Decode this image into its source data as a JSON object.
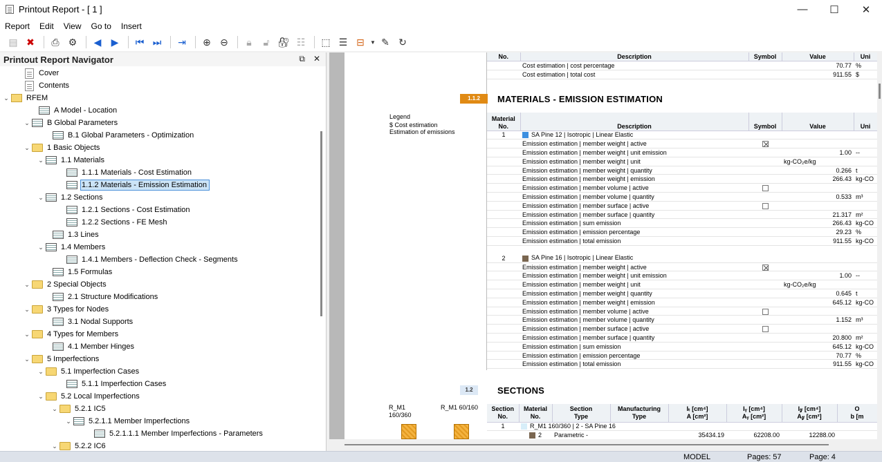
{
  "window": {
    "title": "Printout Report - [ 1 ]",
    "controls": [
      "—",
      "☐",
      "✕"
    ]
  },
  "menu": [
    "Report",
    "Edit",
    "View",
    "Go to",
    "Insert"
  ],
  "toolbar": [
    "new-icon",
    "delete-icon",
    "print-icon",
    "print-settings-icon",
    "back-icon",
    "forward-icon",
    "first-page-icon",
    "last-page-icon",
    "goto-page-icon",
    "zoom-in-icon",
    "zoom-out-icon",
    "lock-icon",
    "unlock-icon",
    "lock-all-icon",
    "columns-icon",
    "page-setup-icon",
    "filter-icon",
    "export-icon",
    "edit-icon",
    "refresh-icon"
  ],
  "navigator": {
    "title": "Printout Report Navigator",
    "pin": "⧉",
    "close": "✕",
    "items": [
      {
        "label": "Cover",
        "icon": "doc",
        "level": 1,
        "tw": ""
      },
      {
        "label": "Contents",
        "icon": "doc",
        "level": 1,
        "tw": ""
      },
      {
        "label": "RFEM",
        "icon": "rfem",
        "level": 0,
        "tw": "⌄"
      },
      {
        "label": "A Model - Location",
        "icon": "table",
        "level": 2,
        "tw": ""
      },
      {
        "label": "B Global Parameters",
        "icon": "table",
        "level": 1.5,
        "tw": "⌄"
      },
      {
        "label": "B.1 Global Parameters - Optimization",
        "icon": "table",
        "level": 3,
        "tw": ""
      },
      {
        "label": "1 Basic Objects",
        "icon": "folder",
        "level": 1.5,
        "tw": "⌄"
      },
      {
        "label": "1.1 Materials",
        "icon": "table",
        "level": 2.5,
        "tw": "⌄"
      },
      {
        "label": "1.1.1 Materials - Cost Estimation",
        "icon": "table",
        "level": 4,
        "tw": ""
      },
      {
        "label": "1.1.2 Materials - Emission Estimation",
        "icon": "table",
        "level": 4,
        "tw": "",
        "selected": true
      },
      {
        "label": "1.2 Sections",
        "icon": "table",
        "level": 2.5,
        "tw": "⌄"
      },
      {
        "label": "1.2.1 Sections - Cost Estimation",
        "icon": "table",
        "level": 4,
        "tw": ""
      },
      {
        "label": "1.2.2 Sections - FE Mesh",
        "icon": "table",
        "level": 4,
        "tw": ""
      },
      {
        "label": "1.3 Lines",
        "icon": "table",
        "level": 3,
        "tw": ""
      },
      {
        "label": "1.4 Members",
        "icon": "table",
        "level": 2.5,
        "tw": "⌄"
      },
      {
        "label": "1.4.1 Members - Deflection Check - Segments",
        "icon": "table",
        "level": 4,
        "tw": ""
      },
      {
        "label": "1.5 Formulas",
        "icon": "table",
        "level": 3,
        "tw": ""
      },
      {
        "label": "2 Special Objects",
        "icon": "folder",
        "level": 1.5,
        "tw": "⌄"
      },
      {
        "label": "2.1 Structure Modifications",
        "icon": "table",
        "level": 3,
        "tw": ""
      },
      {
        "label": "3 Types for Nodes",
        "icon": "folder",
        "level": 1.5,
        "tw": "⌄"
      },
      {
        "label": "3.1 Nodal Supports",
        "icon": "table",
        "level": 3,
        "tw": ""
      },
      {
        "label": "4 Types for Members",
        "icon": "folder",
        "level": 1.5,
        "tw": "⌄"
      },
      {
        "label": "4.1 Member Hinges",
        "icon": "table",
        "level": 3,
        "tw": ""
      },
      {
        "label": "5 Imperfections",
        "icon": "folder",
        "level": 1.5,
        "tw": "⌄"
      },
      {
        "label": "5.1 Imperfection Cases",
        "icon": "folder",
        "level": 2.5,
        "tw": "⌄"
      },
      {
        "label": "5.1.1 Imperfection Cases",
        "icon": "table",
        "level": 4,
        "tw": ""
      },
      {
        "label": "5.2 Local Imperfections",
        "icon": "folder",
        "level": 2.5,
        "tw": "⌄"
      },
      {
        "label": "5.2.1 IC5",
        "icon": "folder",
        "level": 3.5,
        "tw": "⌄"
      },
      {
        "label": "5.2.1.1 Member Imperfections",
        "icon": "table",
        "level": 4.5,
        "tw": "⌄"
      },
      {
        "label": "5.2.1.1.1 Member Imperfections - Parameters",
        "icon": "table",
        "level": 6,
        "tw": ""
      },
      {
        "label": "5.2.2 IC6",
        "icon": "folder",
        "level": 3.5,
        "tw": "⌄"
      }
    ]
  },
  "report": {
    "top_table": {
      "headers": [
        "No.",
        "Description",
        "Symbol",
        "Value",
        "Uni"
      ],
      "rows": [
        [
          "Cost estimation | cost percentage",
          "",
          "70.77",
          "%"
        ],
        [
          "Cost estimation | total cost",
          "",
          "911.55",
          "$"
        ]
      ]
    },
    "section_112": {
      "num": "1.1.2",
      "title": "MATERIALS - EMISSION ESTIMATION"
    },
    "legend": {
      "title": "Legend",
      "items": [
        "$  Cost estimation",
        "Estimation of emissions"
      ]
    },
    "emission_table": {
      "headers": [
        "Material\nNo.",
        "Description",
        "Symbol",
        "Value",
        "Uni"
      ],
      "materials": [
        {
          "no": "1",
          "name": "SA Pine 12 | Isotropic | Linear Elastic",
          "color": "#3d8fe0",
          "rows": [
            [
              "Emission estimation | member weight | active",
              "",
              "cb-on",
              ""
            ],
            [
              "Emission estimation | member weight | unit emission",
              "",
              "1.00",
              "--"
            ],
            [
              "Emission estimation | member weight | unit",
              "",
              "kg-CO₂e/kg",
              ""
            ],
            [
              "Emission estimation | member weight | quantity",
              "",
              "0.266",
              "t"
            ],
            [
              "Emission estimation | member weight | emission",
              "",
              "266.43",
              "kg-CO"
            ],
            [
              "Emission estimation | member volume | active",
              "",
              "cb-off",
              ""
            ],
            [
              "Emission estimation | member volume | quantity",
              "",
              "0.533",
              "m³"
            ],
            [
              "Emission estimation | member surface | active",
              "",
              "cb-off",
              ""
            ],
            [
              "Emission estimation | member surface | quantity",
              "",
              "21.317",
              "m²"
            ],
            [
              "Emission estimation | sum emission",
              "",
              "266.43",
              "kg-CO"
            ],
            [
              "Emission estimation | emission percentage",
              "",
              "29.23",
              "%"
            ],
            [
              "Emission estimation | total emission",
              "",
              "911.55",
              "kg-CO"
            ]
          ]
        },
        {
          "no": "2",
          "name": "SA Pine 16 | Isotropic | Linear Elastic",
          "color": "#7a6650",
          "rows": [
            [
              "Emission estimation | member weight | active",
              "",
              "cb-on",
              ""
            ],
            [
              "Emission estimation | member weight | unit emission",
              "",
              "1.00",
              "--"
            ],
            [
              "Emission estimation | member weight | unit",
              "",
              "kg-CO₂e/kg",
              ""
            ],
            [
              "Emission estimation | member weight | quantity",
              "",
              "0.645",
              "t"
            ],
            [
              "Emission estimation | member weight | emission",
              "",
              "645.12",
              "kg-CO"
            ],
            [
              "Emission estimation | member volume | active",
              "",
              "cb-off",
              ""
            ],
            [
              "Emission estimation | member volume | quantity",
              "",
              "1.152",
              "m³"
            ],
            [
              "Emission estimation | member surface | active",
              "",
              "cb-off",
              ""
            ],
            [
              "Emission estimation | member surface | quantity",
              "",
              "20.800",
              "m²"
            ],
            [
              "Emission estimation | sum emission",
              "",
              "645.12",
              "kg-CO"
            ],
            [
              "Emission estimation | emission percentage",
              "",
              "70.77",
              "%"
            ],
            [
              "Emission estimation | total emission",
              "",
              "911.55",
              "kg-CO"
            ]
          ]
        }
      ]
    },
    "section_12": {
      "num": "1.2",
      "title": "SECTIONS"
    },
    "section_images": [
      "R_M1\n160/360",
      "R_M1 60/160"
    ],
    "sections_table": {
      "headers": [
        [
          "Section",
          "No."
        ],
        [
          "Material",
          "No."
        ],
        [
          "Section",
          "Type"
        ],
        [
          "Manufacturing",
          "Type"
        ],
        [
          "Iₜ [cm⁴]",
          "A [cm²]"
        ],
        [
          "Iᵧ [cm⁴]",
          "Aᵧ [cm²]"
        ],
        [
          "I𝓏 [cm⁴]",
          "A𝓏 [cm²]"
        ],
        [
          "O",
          "b [m"
        ]
      ],
      "rows": [
        [
          "1",
          "",
          "R_M1 160/360 | 2 - SA Pine 16",
          "",
          "",
          "",
          "",
          ""
        ],
        [
          "",
          "2",
          "Parametric -",
          "",
          "35434.19",
          "62208.00",
          "12288.00",
          ""
        ]
      ]
    }
  },
  "status": {
    "model": "MODEL",
    "pages": "Pages: 57",
    "page": "Page: 4"
  }
}
